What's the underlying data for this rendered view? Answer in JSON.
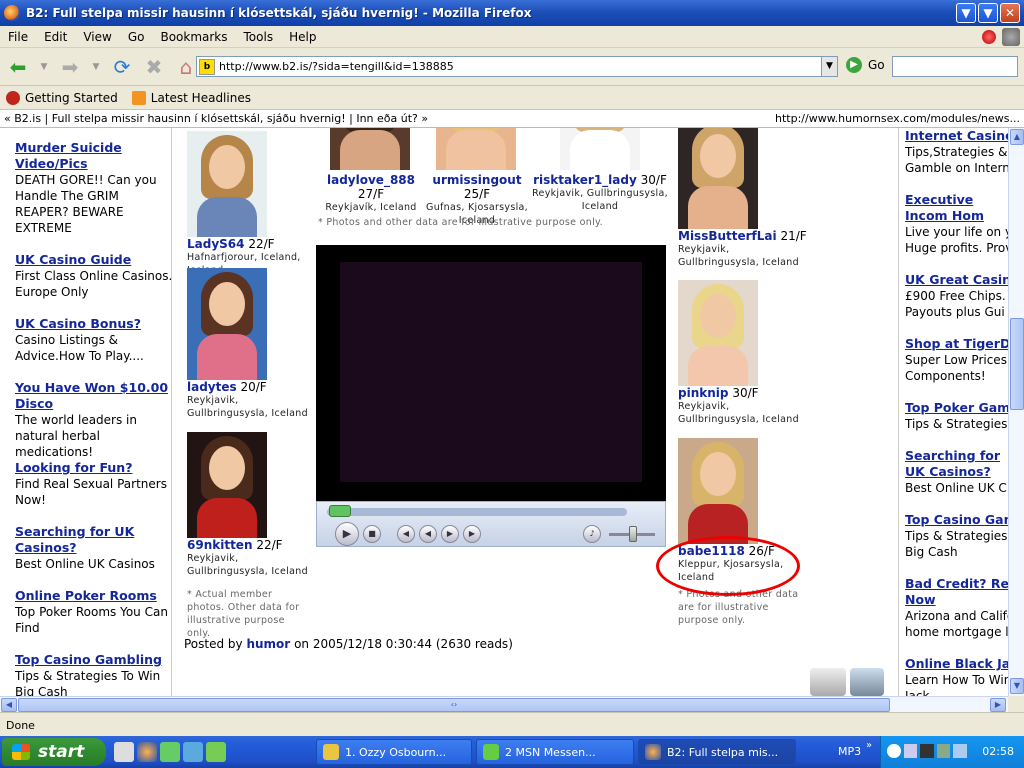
{
  "window": {
    "title": "B2: Full stelpa missir hausinn í klósettskál, sjáðu hvernig! - Mozilla Firefox",
    "buttons": [
      "v",
      "x"
    ]
  },
  "menu": [
    "File",
    "Edit",
    "View",
    "Go",
    "Bookmarks",
    "Tools",
    "Help"
  ],
  "nav": {
    "url": "http://www.b2.is/?sida=tengill&id=138885",
    "go_label": "Go"
  },
  "bookmarks": [
    "Getting Started",
    "Latest Headlines"
  ],
  "ticker": {
    "left": "« B2.is  |  Full stelpa missir hausinn í klósettskál, sjáðu hvernig!  |  Inn eða út? »",
    "right": "http://www.humornsex.com/modules/news..."
  },
  "left_ads": [
    {
      "head": "Murder Suicide Video/Pics",
      "body": "DEATH GORE!! Can you Handle The GRIM REAPER? BEWARE EXTREME"
    },
    {
      "head": "UK Casino Guide",
      "body": "First Class Online Casinos. Europe Only"
    },
    {
      "head": "UK Casino Bonus?",
      "body": "Casino Listings & Advice.How To Play...."
    },
    {
      "head": "You Have Won $10.00 Disco",
      "body": "The world leaders in natural herbal medications!"
    },
    {
      "head": "Looking for Fun?",
      "body": "Find Real Sexual Partners Now!"
    },
    {
      "head": "Searching for UK Casinos?",
      "body": "Best Online UK Casinos"
    },
    {
      "head": "Online Poker Rooms",
      "body": "Top Poker Rooms You Can Find"
    },
    {
      "head": "Top Casino Gambling",
      "body": "Tips & Strategies To Win Big Cash"
    }
  ],
  "right_ads": [
    {
      "head": "Internet Casino",
      "body": "Tips,Strategies & Gamble on Interne"
    },
    {
      "head": "Executive Incom Hom",
      "body": "Live your life on y Huge profits. Prov"
    },
    {
      "head": "UK Great Casino",
      "body": "£900 Free Chips. Payouts plus Gui"
    },
    {
      "head": "Shop at TigerDir",
      "body": "Super Low Prices Components!"
    },
    {
      "head": "Top Poker Gaml",
      "body": "Tips & Strategies"
    },
    {
      "head": "Searching for UK Casinos?",
      "body": "Best Online UK C"
    },
    {
      "head": "Top Casino Gam",
      "body": "Tips & Strategies Big Cash"
    },
    {
      "head": "Bad Credit? Ref Now",
      "body": "Arizona and Califo home mortgage lo"
    },
    {
      "head": "Online Black Ja",
      "body": "Learn How To Win Jack"
    }
  ],
  "top_profiles": [
    {
      "name": "ladylove_888",
      "age": "27/F",
      "loc": "Reykjavík, Iceland"
    },
    {
      "name": "urmissingout",
      "age": "25/F",
      "loc": "Gufnas, Kjosarsysla, Iceland"
    },
    {
      "name": "risktaker1_lady",
      "age": "30/F",
      "loc": "Reykjavik, Gullbringusysla, Iceland"
    }
  ],
  "top_note": "* Photos and other data are for illustrative purpose only.",
  "left_profiles": [
    {
      "name": "LadyS64",
      "age": "22/F",
      "loc": "Hafnarfjorour, Iceland, Iceland"
    },
    {
      "name": "ladytes",
      "age": "20/F",
      "loc": "Reykjavik, Gullbringusysla, Iceland"
    },
    {
      "name": "69nkitten",
      "age": "22/F",
      "loc": "Reykjavik, Gullbringusysla, Iceland"
    }
  ],
  "left_note": "* Actual member photos. Other data for illustrative purpose only.",
  "right_profiles": [
    {
      "name": "MissButterfLai",
      "age": "21/F",
      "loc": "Reykjavik, Gullbringusysla, Iceland"
    },
    {
      "name": "pinknip",
      "age": "30/F",
      "loc": "Reykjavik, Gullbringusysla, Iceland"
    },
    {
      "name": "babe1118",
      "age": "26/F",
      "loc": "Kleppur, Kjosarsysla, Iceland"
    }
  ],
  "right_note": "* Photos and other data are for illustrative purpose only.",
  "posted": {
    "prefix": "Posted by",
    "user": "humor",
    "suffix": "on 2005/12/18 0:30:44 (2630 reads)"
  },
  "status": "Done",
  "taskbar": {
    "start": "start",
    "tasks": [
      "1. Ozzy Osbourn...",
      "2 MSN Messen...",
      "B2: Full stelpa mis..."
    ],
    "mp3": "MP3",
    "clock": "02:58"
  }
}
